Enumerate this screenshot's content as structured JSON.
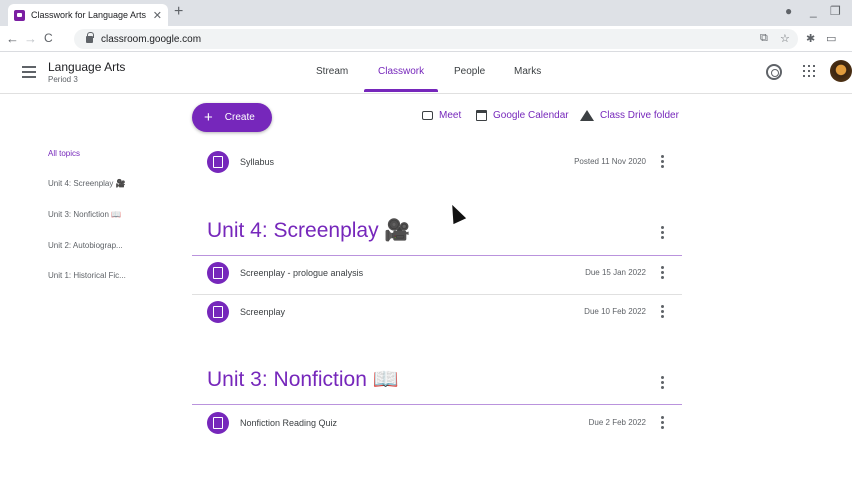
{
  "browser": {
    "tab_title": "Classwork for Language Arts Pe",
    "tab_close": "✕",
    "new_tab": "+",
    "url": "classroom.google.com",
    "back": "←",
    "forward": "→",
    "reload": "C"
  },
  "header": {
    "class_name": "Language Arts",
    "period": "Period 3",
    "tabs": [
      {
        "label": "Stream"
      },
      {
        "label": "Classwork"
      },
      {
        "label": "People"
      },
      {
        "label": "Marks"
      }
    ]
  },
  "sidebar": {
    "items": [
      {
        "label": "All topics"
      },
      {
        "label": "Unit 4: Screenplay 🎥"
      },
      {
        "label": "Unit 3: Nonfiction 📖"
      },
      {
        "label": "Unit 2: Autobiograp..."
      },
      {
        "label": "Unit 1: Historical Fic..."
      }
    ]
  },
  "toolbar": {
    "create_label": "Create",
    "create_plus": "+",
    "meet_label": "Meet",
    "calendar_label": "Google Calendar",
    "drive_label": "Class Drive folder"
  },
  "syllabus": {
    "title": "Syllabus",
    "meta": "Posted 11 Nov 2020"
  },
  "units": [
    {
      "title": "Unit 4: Screenplay 🎥",
      "items": [
        {
          "title": "Screenplay - prologue analysis",
          "meta": "Due 15 Jan 2022"
        },
        {
          "title": "Screenplay",
          "meta": "Due 10 Feb 2022"
        }
      ]
    },
    {
      "title": "Unit 3: Nonfiction 📖",
      "items": [
        {
          "title": "Nonfiction Reading Quiz",
          "meta": "Due 2 Feb 2022"
        }
      ]
    }
  ],
  "colors": {
    "accent": "#7627bb"
  }
}
